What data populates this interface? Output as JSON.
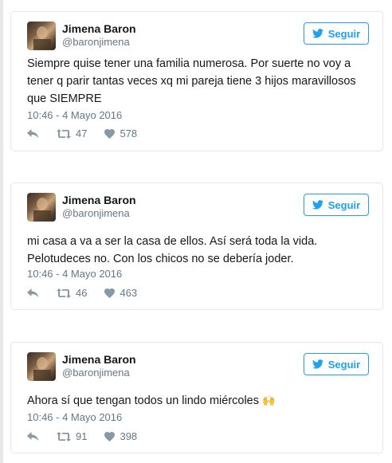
{
  "follow_label": "Seguir",
  "tweets": [
    {
      "name": "Jimena Baron",
      "handle": "@baronjimena",
      "text": "Siempre quise tener una familia numerosa. Por suerte no voy a tener q parir tantas veces xq mi pareja tiene 3 hijos maravillosos que SIEMPRE",
      "timestamp": "10:46 - 4 Mayo 2016",
      "retweets": "47",
      "likes": "578"
    },
    {
      "name": "Jimena Baron",
      "handle": "@baronjimena",
      "text": "mi casa a va a ser la casa de ellos. Así será toda la vida. Pelotudeces no. Con los chicos no se debería joder.",
      "timestamp": "10:46 - 4 Mayo 2016",
      "retweets": "46",
      "likes": "463"
    },
    {
      "name": "Jimena Baron",
      "handle": "@baronjimena",
      "text": "Ahora sí que tengan todos un lindo miércoles",
      "emoji": "🙌",
      "timestamp": "10:46 - 4 Mayo 2016",
      "retweets": "91",
      "likes": "398"
    }
  ],
  "icons": {
    "bird": "twitter-bird-icon",
    "reply": "reply-icon",
    "retweet": "retweet-icon",
    "like": "heart-icon"
  },
  "colors": {
    "accent": "#1da1f2",
    "muted": "#657786",
    "border": "#e1e8ed"
  }
}
